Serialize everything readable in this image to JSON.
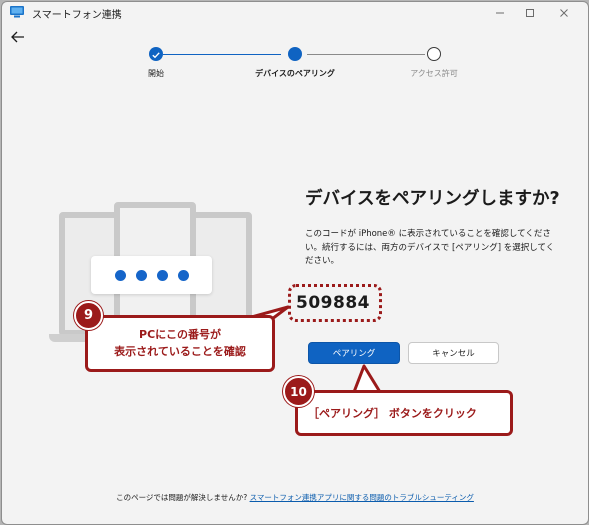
{
  "window": {
    "title": "スマートフォン連携"
  },
  "steps": [
    {
      "label": "開始",
      "state": "done"
    },
    {
      "label": "デバイスのペアリング",
      "state": "current"
    },
    {
      "label": "アクセス許可",
      "state": "pending"
    }
  ],
  "main": {
    "heading": "デバイスをペアリングしますか?",
    "description": "このコードが iPhone® に表示されていることを確認してください。続行するには、両方のデバイスで [ペアリング] を選択してください。",
    "code": "509884",
    "pair_button": "ペアリング",
    "cancel_button": "キャンセル"
  },
  "annotations": {
    "callout9_badge": "9",
    "callout9_line1": "PCにこの番号が",
    "callout9_line2": "表示されていることを確認",
    "callout10_badge": "10",
    "callout10_text": "［ペアリング］ ボタンをクリック"
  },
  "footer": {
    "prefix": "このページでは問題が解決しませんか?",
    "link": "スマートフォン連携アプリに関する問題のトラブルシューティング"
  },
  "colors": {
    "accent": "#0f63c2",
    "annotation": "#9b1a1a",
    "background": "#f3f3f3"
  }
}
